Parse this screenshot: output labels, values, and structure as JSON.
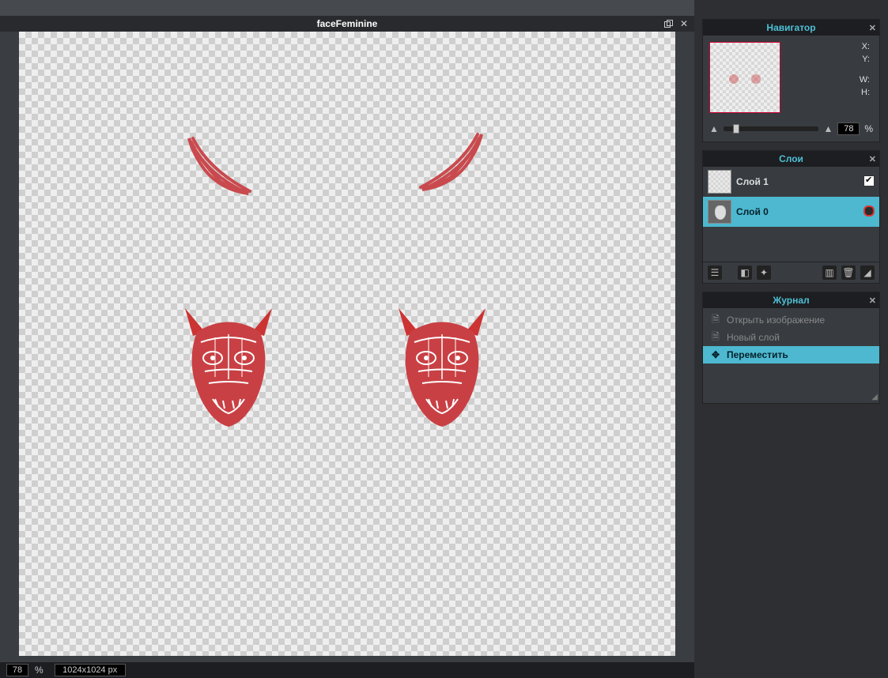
{
  "document": {
    "title": "faceFeminine"
  },
  "status": {
    "zoom": "78",
    "zoom_unit": "%",
    "dimensions": "1024x1024 px"
  },
  "navigator": {
    "title": "Навигатор",
    "x_label": "X:",
    "y_label": "Y:",
    "w_label": "W:",
    "h_label": "H:",
    "zoom_value": "78",
    "zoom_unit": "%"
  },
  "layers_panel": {
    "title": "Слои",
    "layers": [
      {
        "name": "Слой 1",
        "visible": true,
        "selected": false
      },
      {
        "name": "Слой 0",
        "visible": false,
        "selected": true
      }
    ]
  },
  "history_panel": {
    "title": "Журнал",
    "items": [
      {
        "label": "Открыть изображение",
        "dim": true,
        "active": false
      },
      {
        "label": "Новый слой",
        "dim": true,
        "active": false
      },
      {
        "label": "Переместить",
        "dim": false,
        "active": true
      }
    ]
  }
}
